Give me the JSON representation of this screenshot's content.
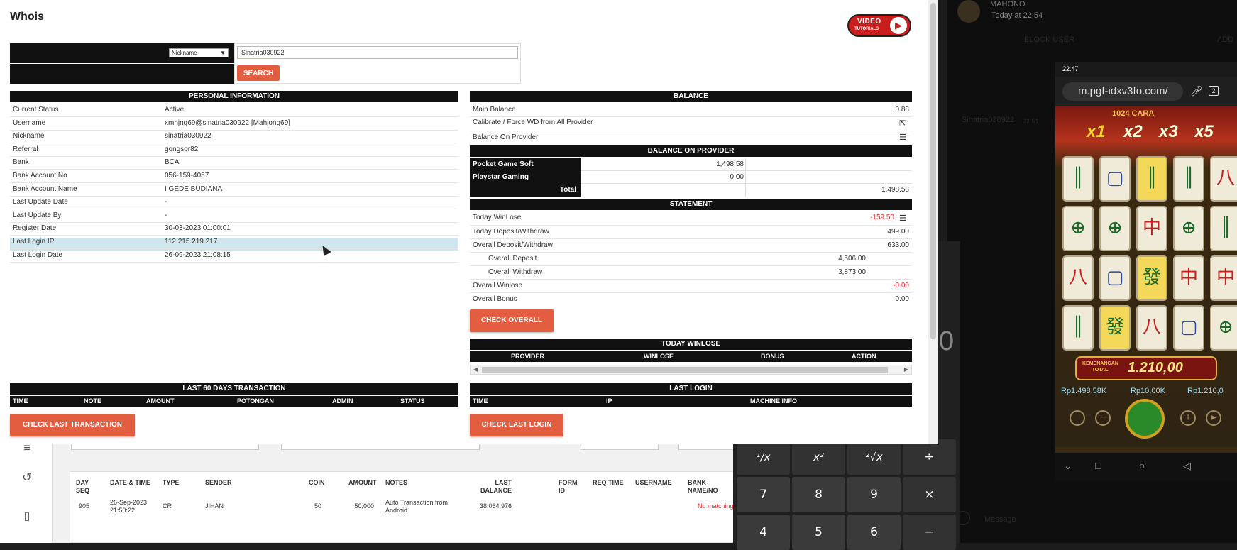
{
  "modal": {
    "title": "Whois",
    "video_btn": {
      "line1": "VIDEO",
      "line2": "TUTORIALS"
    },
    "search": {
      "select_value": "Nickname",
      "input_value": "Sinatria030922",
      "button": "SEARCH"
    },
    "personal": {
      "header": "PERSONAL INFORMATION",
      "rows": [
        {
          "label": "Current Status",
          "value": "Active"
        },
        {
          "label": "Username",
          "value": "xmhjng69@sinatria030922  [Mahjong69]"
        },
        {
          "label": "Nickname",
          "value": "sinatria030922"
        },
        {
          "label": "Referral",
          "value": "gongsor82"
        },
        {
          "label": "Bank",
          "value": "BCA"
        },
        {
          "label": "Bank Account No",
          "value": "056-159-4057"
        },
        {
          "label": "Bank Account Name",
          "value": "I GEDE BUDIANA"
        },
        {
          "label": "Last Update Date",
          "value": "-"
        },
        {
          "label": "Last Update By",
          "value": "-"
        },
        {
          "label": "Register Date",
          "value": "30-03-2023 01:00:01"
        },
        {
          "label": "Last Login IP",
          "value": "112.215.219.217"
        },
        {
          "label": "Last Login Date",
          "value": "26-09-2023 21:08:15"
        }
      ]
    },
    "balance": {
      "header": "BALANCE",
      "main_balance_label": "Main Balance",
      "main_balance_value": "0.88",
      "calibrate_label": "Calibrate / Force WD from All Provider",
      "on_provider_label": "Balance On Provider"
    },
    "provider": {
      "header": "BALANCE ON PROVIDER",
      "rows": [
        {
          "name": "Pocket Game Soft",
          "value": "1,498.58"
        },
        {
          "name": "Playstar Gaming",
          "value": "0.00"
        }
      ],
      "total_label": "Total",
      "total_value": "1,498.58"
    },
    "statement": {
      "header": "STATEMENT",
      "today_winlose_label": "Today WinLose",
      "today_winlose_value": "-159.50",
      "today_dw_label": "Today Deposit/Withdraw",
      "today_dw_value": "499.00",
      "overall_dw_label": "Overall Deposit/Withdraw",
      "overall_dw_value": "633.00",
      "overall_deposit_label": "Overall Deposit",
      "overall_deposit_value": "4,506.00",
      "overall_withdraw_label": "Overall Withdraw",
      "overall_withdraw_value": "3,873.00",
      "overall_winlose_label": "Overall Winlose",
      "overall_winlose_value": "-0.00",
      "overall_bonus_label": "Overall Bonus",
      "overall_bonus_value": "0.00",
      "check_overall": "CHECK OVERALL"
    },
    "today_winlose": {
      "header": "TODAY WINLOSE",
      "columns": [
        "PROVIDER",
        "WINLOSE",
        "BONUS",
        "ACTION"
      ]
    },
    "last60": {
      "header": "LAST 60 DAYS TRANSACTION",
      "columns": [
        "TIME",
        "NOTE",
        "AMOUNT",
        "POTONGAN",
        "ADMIN",
        "STATUS"
      ],
      "button": "CHECK LAST TRANSACTION"
    },
    "last_login": {
      "header": "LAST LOGIN",
      "columns": [
        "TIME",
        "IP",
        "MACHINE INFO"
      ],
      "button": "CHECK LAST LOGIN"
    }
  },
  "bg_table": {
    "headers": [
      "DAY SEQ",
      "DATE & TIME",
      "TYPE",
      "SENDER",
      "COIN",
      "AMOUNT",
      "NOTES",
      "LAST BALANCE",
      "FORM ID",
      "REQ TIME",
      "USERNAME",
      "BANK NAME/NO"
    ],
    "row": {
      "seq": "905",
      "datetime": "26-Sep-2023 21:50:22",
      "type": "CR",
      "sender": "JIHAN",
      "coin": "50",
      "amount": "50,000",
      "notes": "Auto Transaction from Android",
      "last_balance": "38,064,976",
      "bank": "No matching"
    }
  },
  "calculator": {
    "keys_row1": [
      "¹/x",
      "x²",
      "²√x",
      "÷"
    ],
    "keys_row2": [
      "7",
      "8",
      "9",
      "×"
    ],
    "keys_row3": [
      "4",
      "5",
      "6",
      "−"
    ],
    "display_digit": "0"
  },
  "chat": {
    "header_name": "MAHONO",
    "header_time": "Today at 22:54",
    "block_user": "BLOCK USER",
    "add": "ADD",
    "msg_sender": "Sinatria030922",
    "msg_time": "22:51",
    "msg_placeholder": "Message"
  },
  "phone": {
    "status_time": "22.47",
    "url": "m.pgf-idxv3fo.com/",
    "game_title": "1024 CARA",
    "multipliers": [
      "x1",
      "x2",
      "x3",
      "x5"
    ],
    "win_label": "KEMENANGAN TOTAL",
    "win_value": "1.210,00",
    "stat1": "Rp1.498,58K",
    "stat2": "Rp10,00K",
    "stat3": "Rp1.210,0"
  },
  "colors": {
    "accent": "#e35d40",
    "header_bg": "#111111",
    "highlight_row": "#cfe6ee",
    "negative": "#e03030"
  }
}
